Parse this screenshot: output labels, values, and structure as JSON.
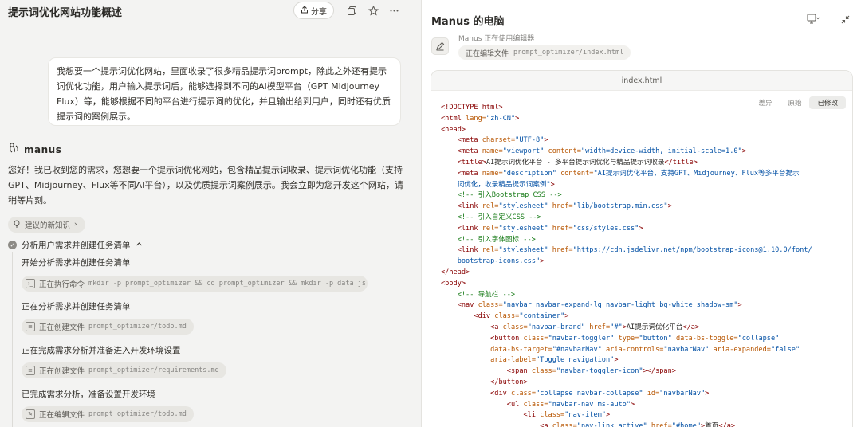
{
  "left": {
    "title": "提示词优化网站功能概述",
    "share_label": "分享",
    "user_message": "我想要一个提示词优化网站，里面收录了很多精品提示词prompt，除此之外还有提示词优化功能，用户输入提示词后，能够选择到不同的AI模型平台（GPT Midjourney Flux）等，能够根据不同的平台进行提示词的优化，并且输出给到用户，同时还有优质提示词的案例展示。",
    "assistant_name": "manus",
    "assistant_reply": "您好！我已收到您的需求，您想要一个提示词优化网站，包含精品提示词收录、提示词优化功能（支持GPT、Midjourney、Flux等不同AI平台），以及优质提示词案例展示。我会立即为您开发这个网站，请稍等片刻。",
    "knowledge_chip": "建议的新知识",
    "task_title": "分析用户需求并创建任务清单",
    "steps": [
      {
        "label": "开始分析需求并创建任务清单",
        "chip_action": "正在执行命令",
        "chip_detail": "mkdir -p prompt_optimizer && cd prompt_optimizer && mkdir -p data js ..."
      },
      {
        "label": "正在分析需求并创建任务清单",
        "chip_action": "正在创建文件",
        "chip_detail": "prompt_optimizer/todo.md"
      },
      {
        "label": "正在完成需求分析并准备进入开发环境设置",
        "chip_action": "正在创建文件",
        "chip_detail": "prompt_optimizer/requirements.md"
      },
      {
        "label": "已完成需求分析，准备设置开发环境",
        "chip_action": "正在编辑文件",
        "chip_detail": "prompt_optimizer/todo.md"
      }
    ]
  },
  "right": {
    "title": "Manus 的电脑",
    "agent_status": "Manus 正在使用编辑器",
    "agent_action": "正在编辑文件",
    "agent_file": "prompt_optimizer/index.html",
    "editor_filename": "index.html",
    "modes": [
      "差异",
      "原始",
      "已修改"
    ],
    "active_mode": "已修改"
  },
  "code_lines": [
    [
      [
        "t",
        "<!DOCTYPE html>"
      ]
    ],
    [
      [
        "t",
        "<html "
      ],
      [
        "a",
        "lang="
      ],
      [
        "s",
        "\"zh-CN\""
      ],
      [
        "t",
        ">"
      ]
    ],
    [
      [
        "t",
        "<head>"
      ]
    ],
    [
      [
        "p",
        "    "
      ],
      [
        "t",
        "<meta "
      ],
      [
        "a",
        "charset="
      ],
      [
        "s",
        "\"UTF-8\""
      ],
      [
        "t",
        ">"
      ]
    ],
    [
      [
        "p",
        "    "
      ],
      [
        "t",
        "<meta "
      ],
      [
        "a",
        "name="
      ],
      [
        "s",
        "\"viewport\" "
      ],
      [
        "a",
        "content="
      ],
      [
        "s",
        "\"width=device-width, initial-scale=1.0\""
      ],
      [
        "t",
        ">"
      ]
    ],
    [
      [
        "p",
        "    "
      ],
      [
        "t",
        "<title>"
      ],
      [
        "p",
        "AI提示词优化平台 - 多平台提示词优化与精品提示词收录"
      ],
      [
        "t",
        "</title>"
      ]
    ],
    [
      [
        "p",
        "    "
      ],
      [
        "t",
        "<meta "
      ],
      [
        "a",
        "name="
      ],
      [
        "s",
        "\"description\" "
      ],
      [
        "a",
        "content="
      ],
      [
        "s",
        "\"AI提示词优化平台，支持GPT、Midjourney、Flux等多平台提示"
      ]
    ],
    [
      [
        "s",
        "    词优化，收录精品提示词案例\""
      ],
      [
        "t",
        ">"
      ]
    ],
    [
      [
        "p",
        "    "
      ],
      [
        "c",
        "<!-- 引入Bootstrap CSS -->"
      ]
    ],
    [
      [
        "p",
        "    "
      ],
      [
        "t",
        "<link "
      ],
      [
        "a",
        "rel="
      ],
      [
        "s",
        "\"stylesheet\" "
      ],
      [
        "a",
        "href="
      ],
      [
        "s",
        "\"lib/bootstrap.min.css\""
      ],
      [
        "t",
        ">"
      ]
    ],
    [
      [
        "p",
        "    "
      ],
      [
        "c",
        "<!-- 引入自定义CSS -->"
      ]
    ],
    [
      [
        "p",
        "    "
      ],
      [
        "t",
        "<link "
      ],
      [
        "a",
        "rel="
      ],
      [
        "s",
        "\"stylesheet\" "
      ],
      [
        "a",
        "href="
      ],
      [
        "s",
        "\"css/styles.css\""
      ],
      [
        "t",
        ">"
      ]
    ],
    [
      [
        "p",
        "    "
      ],
      [
        "c",
        "<!-- 引入字体图标 -->"
      ]
    ],
    [
      [
        "p",
        "    "
      ],
      [
        "t",
        "<link "
      ],
      [
        "a",
        "rel="
      ],
      [
        "s",
        "\"stylesheet\" "
      ],
      [
        "a",
        "href="
      ],
      [
        "s",
        "\""
      ],
      [
        "u",
        "https://cdn.jsdelivr.net/npm/bootstrap-icons@1.10.0/font/"
      ]
    ],
    [
      [
        "u",
        "    bootstrap-icons.css"
      ],
      [
        "s",
        "\""
      ],
      [
        "t",
        ">"
      ]
    ],
    [
      [
        "t",
        "</head>"
      ]
    ],
    [
      [
        "t",
        "<body>"
      ]
    ],
    [
      [
        "p",
        "    "
      ],
      [
        "c",
        "<!-- 导航栏 -->"
      ]
    ],
    [
      [
        "p",
        "    "
      ],
      [
        "t",
        "<nav "
      ],
      [
        "a",
        "class="
      ],
      [
        "s",
        "\"navbar navbar-expand-lg navbar-light bg-white shadow-sm\""
      ],
      [
        "t",
        ">"
      ]
    ],
    [
      [
        "p",
        "        "
      ],
      [
        "t",
        "<div "
      ],
      [
        "a",
        "class="
      ],
      [
        "s",
        "\"container\""
      ],
      [
        "t",
        ">"
      ]
    ],
    [
      [
        "p",
        "            "
      ],
      [
        "t",
        "<a "
      ],
      [
        "a",
        "class="
      ],
      [
        "s",
        "\"navbar-brand\" "
      ],
      [
        "a",
        "href="
      ],
      [
        "s",
        "\"#\""
      ],
      [
        "t",
        ">"
      ],
      [
        "p",
        "AI提示词优化平台"
      ],
      [
        "t",
        "</a>"
      ]
    ],
    [
      [
        "p",
        "            "
      ],
      [
        "t",
        "<button "
      ],
      [
        "a",
        "class="
      ],
      [
        "s",
        "\"navbar-toggler\" "
      ],
      [
        "a",
        "type="
      ],
      [
        "s",
        "\"button\" "
      ],
      [
        "a",
        "data-bs-toggle="
      ],
      [
        "s",
        "\"collapse\""
      ]
    ],
    [
      [
        "a",
        "            data-bs-target="
      ],
      [
        "s",
        "\"#navbarNav\" "
      ],
      [
        "a",
        "aria-controls="
      ],
      [
        "s",
        "\"navbarNav\" "
      ],
      [
        "a",
        "aria-expanded="
      ],
      [
        "s",
        "\"false\""
      ]
    ],
    [
      [
        "a",
        "            aria-label="
      ],
      [
        "s",
        "\"Toggle navigation\""
      ],
      [
        "t",
        ">"
      ]
    ],
    [
      [
        "p",
        "                "
      ],
      [
        "t",
        "<span "
      ],
      [
        "a",
        "class="
      ],
      [
        "s",
        "\"navbar-toggler-icon\""
      ],
      [
        "t",
        "></span>"
      ]
    ],
    [
      [
        "p",
        "            "
      ],
      [
        "t",
        "</button>"
      ]
    ],
    [
      [
        "p",
        "            "
      ],
      [
        "t",
        "<div "
      ],
      [
        "a",
        "class="
      ],
      [
        "s",
        "\"collapse navbar-collapse\" "
      ],
      [
        "a",
        "id="
      ],
      [
        "s",
        "\"navbarNav\""
      ],
      [
        "t",
        ">"
      ]
    ],
    [
      [
        "p",
        "                "
      ],
      [
        "t",
        "<ul "
      ],
      [
        "a",
        "class="
      ],
      [
        "s",
        "\"navbar-nav ms-auto\""
      ],
      [
        "t",
        ">"
      ]
    ],
    [
      [
        "p",
        "                    "
      ],
      [
        "t",
        "<li "
      ],
      [
        "a",
        "class="
      ],
      [
        "s",
        "\"nav-item\""
      ],
      [
        "t",
        ">"
      ]
    ],
    [
      [
        "p",
        "                        "
      ],
      [
        "t",
        "<a "
      ],
      [
        "a",
        "class="
      ],
      [
        "s",
        "\"nav-link active\" "
      ],
      [
        "a",
        "href="
      ],
      [
        "s",
        "\"#home\""
      ],
      [
        "t",
        ">"
      ],
      [
        "p",
        "首页"
      ],
      [
        "t",
        "</a>"
      ]
    ]
  ]
}
